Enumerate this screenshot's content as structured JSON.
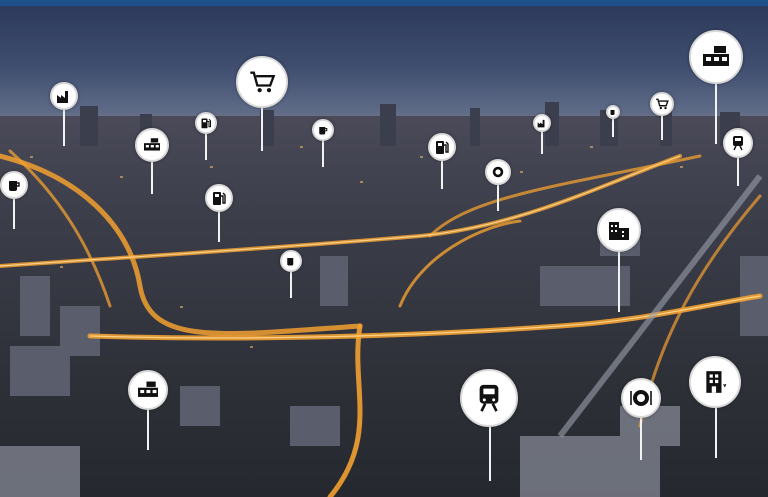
{
  "image": {
    "description_colors": {
      "sky_top": "#2d3a5c",
      "highway_glow": "#f2a030",
      "pin_fill": "#ffffff",
      "icon": "#111111",
      "top_bar": "#1d4f8a"
    }
  },
  "pins": [
    {
      "icon": "shopping-cart-icon"
    },
    {
      "icon": "bus-stop-icon"
    },
    {
      "icon": "factory-icon"
    },
    {
      "icon": "fuel-pump-icon"
    },
    {
      "icon": "coffee-cup-icon"
    },
    {
      "icon": "dining-plate-icon"
    },
    {
      "icon": "office-buildings-icon"
    },
    {
      "icon": "train-icon"
    },
    {
      "icon": "hotel-icon"
    }
  ]
}
